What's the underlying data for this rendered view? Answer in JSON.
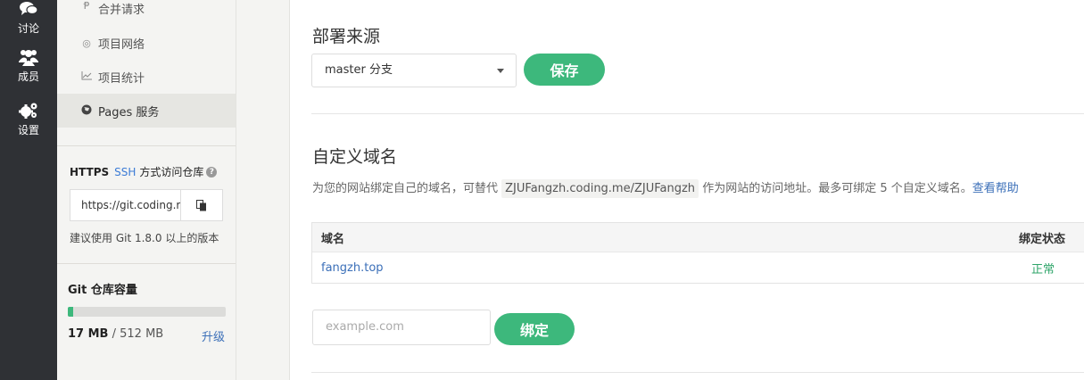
{
  "rail": {
    "items": [
      {
        "label": "讨论",
        "icon": "chat-bubbles-icon"
      },
      {
        "label": "成员",
        "icon": "users-icon"
      },
      {
        "label": "设置",
        "icon": "gears-icon"
      }
    ]
  },
  "sidebar": {
    "items": [
      {
        "label": "合并请求",
        "icon": "merge-request-icon"
      },
      {
        "label": "项目网络",
        "icon": "network-icon"
      },
      {
        "label": "项目统计",
        "icon": "stats-chart-icon"
      },
      {
        "label": "Pages 服务",
        "icon": "globe-icon",
        "active": true
      }
    ],
    "clone": {
      "https_label": "HTTPS",
      "ssh_label": "SSH",
      "suffix": "方式访问仓库",
      "url": "https://git.coding.r",
      "hint": "建议使用 Git 1.8.0 以上的版本"
    },
    "capacity": {
      "title": "Git 仓库容量",
      "used": "17 MB",
      "total": "/ 512 MB",
      "used_fraction": 0.033,
      "upgrade": "升级"
    }
  },
  "deploy": {
    "title": "部署来源",
    "branch": "master 分支",
    "save": "保存"
  },
  "domain": {
    "title": "自定义域名",
    "desc_before": "为您的网站绑定自己的域名，可替代",
    "desc_code": "ZJUFangzh.coding.me/ZJUFangzh",
    "desc_after": "作为网站的访问地址。最多可绑定 5 个自定义域名。",
    "help": "查看帮助",
    "columns": [
      "域名",
      "绑定状态"
    ],
    "rows": [
      {
        "domain": "fangzh.top",
        "status": "正常"
      }
    ],
    "input_placeholder": "example.com",
    "bind": "绑定"
  },
  "colors": {
    "accent": "#3db87c",
    "link": "#3b6fb8",
    "rail": "#2f3135"
  }
}
